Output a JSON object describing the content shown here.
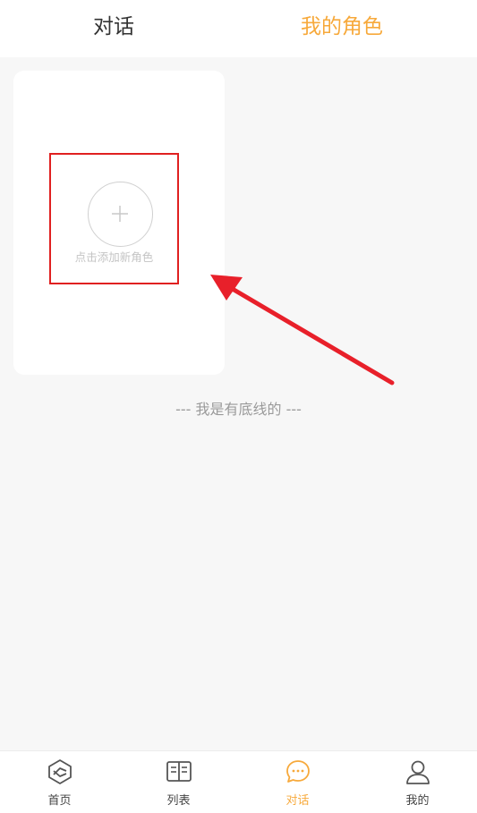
{
  "top_tabs": [
    {
      "label": "对话",
      "active": false
    },
    {
      "label": "我的角色",
      "active": true
    }
  ],
  "role_card": {
    "add_icon": "plus-icon",
    "add_label": "点击添加新角色"
  },
  "footer_text": "--- 我是有底线的 ---",
  "bottom_nav": [
    {
      "label": "首页",
      "icon": "home-icon",
      "active": false
    },
    {
      "label": "列表",
      "icon": "book-icon",
      "active": false
    },
    {
      "label": "对话",
      "icon": "chat-icon",
      "active": true
    },
    {
      "label": "我的",
      "icon": "user-icon",
      "active": false
    }
  ],
  "colors": {
    "accent": "#f7a93b",
    "highlight_box": "#e02020",
    "arrow": "#e8202a"
  }
}
